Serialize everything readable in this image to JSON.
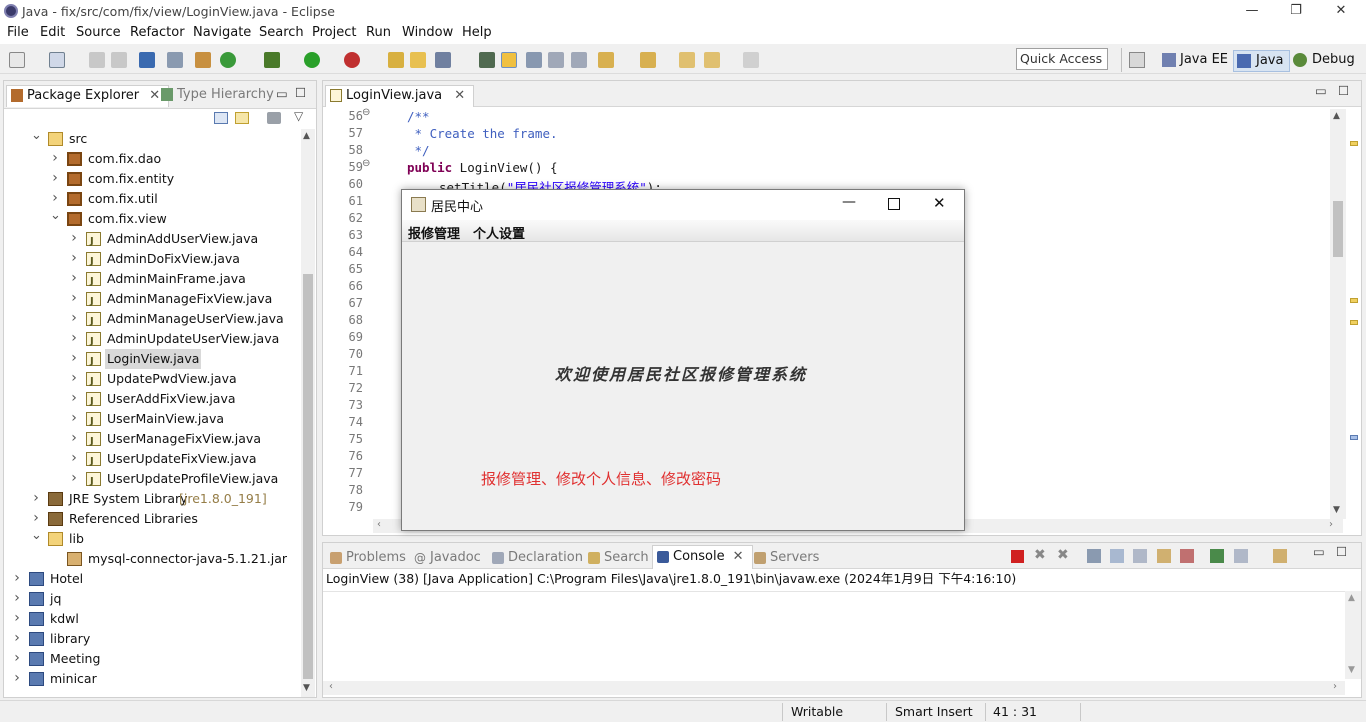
{
  "window": {
    "title": "Java - fix/src/com/fix/view/LoginView.java - Eclipse"
  },
  "menu": [
    "File",
    "Edit",
    "Source",
    "Refactor",
    "Navigate",
    "Search",
    "Project",
    "Run",
    "Window",
    "Help"
  ],
  "quick_access": {
    "placeholder": "Quick Access"
  },
  "perspectives": [
    "Java EE",
    "Java",
    "Debug"
  ],
  "explorer": {
    "tabs": [
      "Package Explorer",
      "Type Hierarchy"
    ],
    "rows": [
      {
        "label": "src",
        "indent": 1,
        "icon": "src-folder-icon",
        "state": "open"
      },
      {
        "label": "com.fix.dao",
        "indent": 2,
        "icon": "package-icon",
        "state": "closed"
      },
      {
        "label": "com.fix.entity",
        "indent": 2,
        "icon": "package-icon",
        "state": "closed"
      },
      {
        "label": "com.fix.util",
        "indent": 2,
        "icon": "package-icon",
        "state": "closed"
      },
      {
        "label": "com.fix.view",
        "indent": 2,
        "icon": "package-icon",
        "state": "open"
      },
      {
        "label": "AdminAddUserView.java",
        "indent": 3,
        "icon": "java-file-icon",
        "state": "closed"
      },
      {
        "label": "AdminDoFixView.java",
        "indent": 3,
        "icon": "java-file-icon",
        "state": "closed"
      },
      {
        "label": "AdminMainFrame.java",
        "indent": 3,
        "icon": "java-file-icon",
        "state": "closed"
      },
      {
        "label": "AdminManageFixView.java",
        "indent": 3,
        "icon": "java-file-icon",
        "state": "closed"
      },
      {
        "label": "AdminManageUserView.java",
        "indent": 3,
        "icon": "java-file-icon",
        "state": "closed"
      },
      {
        "label": "AdminUpdateUserView.java",
        "indent": 3,
        "icon": "java-file-icon",
        "state": "closed"
      },
      {
        "label": "LoginView.java",
        "indent": 3,
        "icon": "java-file-icon",
        "state": "closed",
        "selected": true
      },
      {
        "label": "UpdatePwdView.java",
        "indent": 3,
        "icon": "java-file-icon",
        "state": "closed"
      },
      {
        "label": "UserAddFixView.java",
        "indent": 3,
        "icon": "java-file-icon",
        "state": "closed"
      },
      {
        "label": "UserMainView.java",
        "indent": 3,
        "icon": "java-file-icon",
        "state": "closed"
      },
      {
        "label": "UserManageFixView.java",
        "indent": 3,
        "icon": "java-file-icon",
        "state": "closed"
      },
      {
        "label": "UserUpdateFixView.java",
        "indent": 3,
        "icon": "java-file-icon",
        "state": "closed"
      },
      {
        "label": "UserUpdateProfileView.java",
        "indent": 3,
        "icon": "java-file-icon",
        "state": "closed"
      },
      {
        "label": "JRE System Library",
        "suffix": "[jre1.8.0_191]",
        "indent": 1,
        "icon": "library-icon",
        "state": "closed"
      },
      {
        "label": "Referenced Libraries",
        "indent": 1,
        "icon": "library-icon",
        "state": "closed"
      },
      {
        "label": "lib",
        "indent": 1,
        "icon": "folder-icon",
        "state": "open"
      },
      {
        "label": "mysql-connector-java-5.1.21.jar",
        "indent": 2,
        "icon": "jar-icon",
        "state": "none"
      },
      {
        "label": "Hotel",
        "indent": 0,
        "icon": "project-icon",
        "state": "closed"
      },
      {
        "label": "jq",
        "indent": 0,
        "icon": "project-icon",
        "state": "closed"
      },
      {
        "label": "kdwl",
        "indent": 0,
        "icon": "project-icon",
        "state": "closed"
      },
      {
        "label": "library",
        "indent": 0,
        "icon": "project-icon",
        "state": "closed"
      },
      {
        "label": "Meeting",
        "indent": 0,
        "icon": "project-icon",
        "state": "closed"
      },
      {
        "label": "minicar",
        "indent": 0,
        "icon": "project-icon",
        "state": "closed"
      }
    ]
  },
  "editor": {
    "tab": "LoginView.java",
    "line_numbers": [
      "56",
      "57",
      "58",
      "59",
      "60",
      "61",
      "62",
      "63",
      "64",
      "65",
      "66",
      "67",
      "68",
      "69",
      "70",
      "71",
      "72",
      "73",
      "74",
      "75",
      "76",
      "77",
      "78",
      "79"
    ],
    "code": {
      "l56": "/**",
      "l57": " * Create the frame.",
      "l58": " */",
      "l59_kw": "public",
      "l59_rest": " LoginView() {",
      "l60_pre": "setTitle(",
      "l60_str": "\"居民社区报修管理系统\"",
      "l60_post": ");"
    }
  },
  "dialog": {
    "title": "居民中心",
    "menu": [
      "报修管理",
      "个人设置"
    ],
    "welcome": "欢迎使用居民社区报修管理系统",
    "note": "报修管理、修改个人信息、修改密码"
  },
  "console": {
    "tabs": [
      "Problems",
      "Javadoc",
      "Declaration",
      "Search",
      "Console",
      "Servers"
    ],
    "active_tab": "Console",
    "launch": "LoginView (38) [Java Application] C:\\Program Files\\Java\\jre1.8.0_191\\bin\\javaw.exe (2024年1月9日 下午4:16:10)"
  },
  "status": {
    "writable": "Writable",
    "insert": "Smart Insert",
    "position": "41 : 31"
  }
}
